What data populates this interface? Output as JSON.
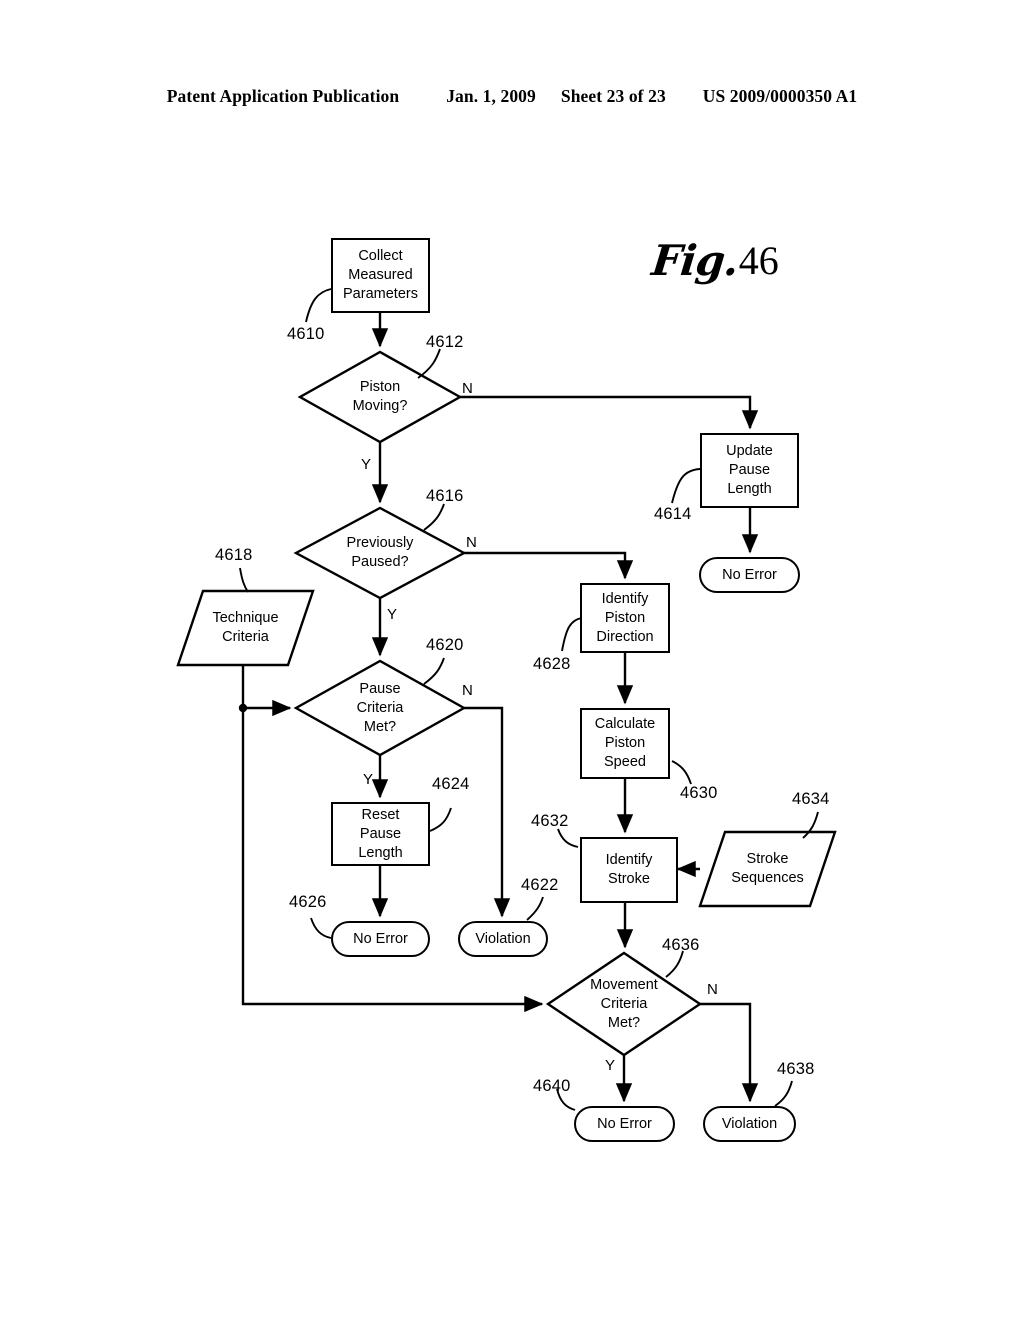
{
  "header": {
    "publication": "Patent Application Publication",
    "date": "Jan. 1, 2009",
    "sheet": "Sheet 23 of 23",
    "number": "US 2009/0000350 A1"
  },
  "figure": {
    "word": "Fig.",
    "number": "46"
  },
  "nodes": [
    {
      "id": "n4610",
      "ref": "4610",
      "type": "process",
      "label": "Collect\nMeasured\nParameters"
    },
    {
      "id": "n4612",
      "ref": "4612",
      "type": "decision",
      "label": "Piston\nMoving?"
    },
    {
      "id": "n4614",
      "ref": "4614",
      "type": "process",
      "label": "Update\nPause\nLength"
    },
    {
      "id": "n4615",
      "ref": "",
      "type": "terminator",
      "label": "No Error"
    },
    {
      "id": "n4616",
      "ref": "4616",
      "type": "decision",
      "label": "Previously\nPaused?"
    },
    {
      "id": "n4618",
      "ref": "4618",
      "type": "data",
      "label": "Technique\nCriteria"
    },
    {
      "id": "n4620",
      "ref": "4620",
      "type": "decision",
      "label": "Pause\nCriteria\nMet?"
    },
    {
      "id": "n4622",
      "ref": "4622",
      "type": "terminator",
      "label": "Violation"
    },
    {
      "id": "n4624",
      "ref": "4624",
      "type": "process",
      "label": "Reset\nPause\nLength"
    },
    {
      "id": "n4626",
      "ref": "4626",
      "type": "terminator",
      "label": "No Error"
    },
    {
      "id": "n4628",
      "ref": "4628",
      "type": "process",
      "label": "Identify\nPiston\nDirection"
    },
    {
      "id": "n4630",
      "ref": "4630",
      "type": "process",
      "label": "Calculate\nPiston\nSpeed"
    },
    {
      "id": "n4632",
      "ref": "4632",
      "type": "process",
      "label": "Identify\nStroke"
    },
    {
      "id": "n4634",
      "ref": "4634",
      "type": "data",
      "label": "Stroke\nSequences"
    },
    {
      "id": "n4636",
      "ref": "4636",
      "type": "decision",
      "label": "Movement\nCriteria\nMet?"
    },
    {
      "id": "n4638",
      "ref": "4638",
      "type": "terminator",
      "label": "Violation"
    },
    {
      "id": "n4640",
      "ref": "4640",
      "type": "terminator",
      "label": "No Error"
    }
  ],
  "edge_labels": [
    {
      "id": "e1",
      "text": "N",
      "from": "n4612"
    },
    {
      "id": "e2",
      "text": "Y",
      "from": "n4612"
    },
    {
      "id": "e3",
      "text": "N",
      "from": "n4616"
    },
    {
      "id": "e4",
      "text": "Y",
      "from": "n4616"
    },
    {
      "id": "e5",
      "text": "N",
      "from": "n4620"
    },
    {
      "id": "e6",
      "text": "Y",
      "from": "n4620"
    },
    {
      "id": "e7",
      "text": "N",
      "from": "n4636"
    },
    {
      "id": "e8",
      "text": "Y",
      "from": "n4636"
    }
  ],
  "style": {
    "ink": "#000000",
    "paper": "#ffffff"
  }
}
